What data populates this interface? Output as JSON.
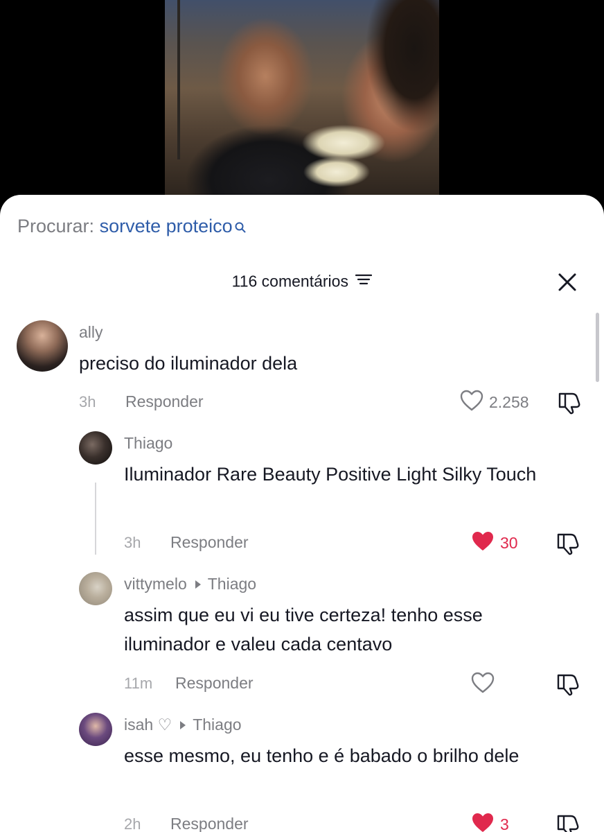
{
  "search": {
    "prefix": "Procurar:",
    "term": "sorvete proteico"
  },
  "header": {
    "comment_count_label": "116 comentários"
  },
  "colors": {
    "link_blue": "#2f5da9",
    "like_red": "#e0294d",
    "text_gray": "#7c7d82"
  },
  "comments": [
    {
      "username": "ally",
      "text": "preciso do iluminador dela",
      "time": "3h",
      "reply_label": "Responder",
      "likes": "2.258",
      "liked": false
    },
    {
      "username": "Thiago",
      "text": "Iluminador Rare Beauty Positive Light Silky Touch",
      "time": "3h",
      "reply_label": "Responder",
      "likes": "30",
      "liked": true
    },
    {
      "username": "vittymelo",
      "reply_to": "Thiago",
      "text": "assim que eu vi eu tive certeza! tenho esse iluminador e valeu cada centavo",
      "time": "11m",
      "reply_label": "Responder",
      "likes": "",
      "liked": false
    },
    {
      "username": "isah ♡",
      "reply_to": "Thiago",
      "text": "esse mesmo, eu tenho e é babado o brilho dele",
      "time": "2h",
      "reply_label": "Responder",
      "likes": "3",
      "liked": true
    }
  ]
}
